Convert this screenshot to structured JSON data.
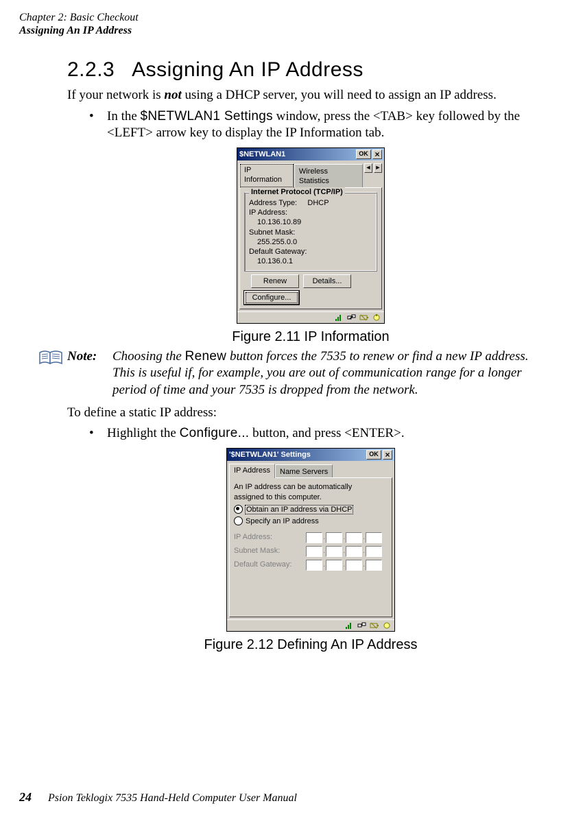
{
  "header": {
    "line1": "Chapter 2: Basic Checkout",
    "line2": "Assigning An IP Address"
  },
  "section": {
    "number": "2.2.3",
    "title": "Assigning An IP Address"
  },
  "intro": {
    "before_not": "If your network is ",
    "not": "not",
    "after_not": " using a DHCP server, you will need to assign an IP address."
  },
  "bullet1": {
    "prefix": "In the ",
    "setting": "$NETWLAN1 Settings",
    "rest": " window, press the <TAB> key followed by the <LEFT> arrow key to display the IP Information tab."
  },
  "fig1": {
    "title": "$NETWLAN1",
    "ok": "OK",
    "close": "×",
    "tab_ip": "IP Information",
    "tab_ws": "Wireless Statistics",
    "arrow_left": "◄",
    "arrow_right": "►",
    "group_title": "Internet Protocol (TCP/IP)",
    "addr_type_label": "Address Type:",
    "addr_type_value": "DHCP",
    "ip_label": "IP Address:",
    "ip_value": "10.136.10.89",
    "mask_label": "Subnet Mask:",
    "mask_value": "255.255.0.0",
    "gw_label": "Default Gateway:",
    "gw_value": "10.136.0.1",
    "renew": "Renew",
    "details": "Details...",
    "configure": "Configure...",
    "caption": "Figure 2.11 IP Information"
  },
  "note": {
    "label": "Note:",
    "before_renew": "Choosing the ",
    "renew": "Renew",
    "after_renew": " button forces the 7535 to renew or find a new IP address. This is useful if, for example, you are out of communication range for a longer period of time and your 7535 is dropped from the net­work."
  },
  "static_line": "To define a static IP address:",
  "bullet2": {
    "prefix": "Highlight the ",
    "configure": "Configure...",
    "rest": " button, and press <ENTER>."
  },
  "fig2": {
    "title": "'$NETWLAN1' Settings",
    "ok": "OK",
    "close": "×",
    "tab_ip": "IP Address",
    "tab_ns": "Name Servers",
    "desc1": "An IP address can be automatically",
    "desc2": "assigned to this computer.",
    "opt_dhcp": "Obtain an IP address via DHCP",
    "opt_static": "Specify an IP address",
    "ip_label": "IP Address:",
    "mask_label": "Subnet Mask:",
    "gw_label": "Default Gateway:",
    "dot": ".",
    "caption": "Figure 2.12 Defining An IP Address"
  },
  "footer": {
    "page": "24",
    "text": "Psion Teklogix 7535 Hand-Held Computer User Manual"
  }
}
